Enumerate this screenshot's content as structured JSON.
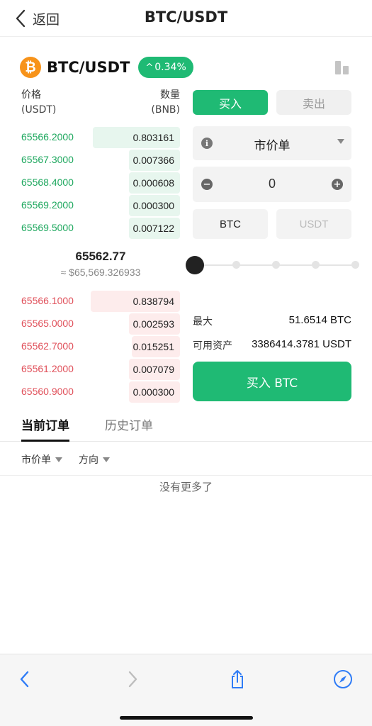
{
  "nav": {
    "back_label": "返回",
    "title": "BTC/USDT"
  },
  "pair": {
    "coin_symbol": "₿",
    "name": "BTC/USDT",
    "change": "0.34%",
    "change_color": "#1fba74"
  },
  "orderbook": {
    "price_header": "价格",
    "price_unit": "(USDT)",
    "qty_header": "数量",
    "qty_unit": "(BNB)",
    "bids": [
      {
        "price": "65566.2000",
        "qty": "0.803161",
        "depth": 0.55
      },
      {
        "price": "65567.3000",
        "qty": "0.007366",
        "depth": 0.32
      },
      {
        "price": "65568.4000",
        "qty": "0.000608",
        "depth": 0.32
      },
      {
        "price": "65569.2000",
        "qty": "0.000300",
        "depth": 0.32
      },
      {
        "price": "65569.5000",
        "qty": "0.007122",
        "depth": 0.32
      }
    ],
    "last_price": "65562.77",
    "last_price_usd": "≈ $65,569.326933",
    "asks": [
      {
        "price": "65566.1000",
        "qty": "0.838794",
        "depth": 0.56
      },
      {
        "price": "65565.0000",
        "qty": "0.002593",
        "depth": 0.32
      },
      {
        "price": "65562.7000",
        "qty": "0.015251",
        "depth": 0.3
      },
      {
        "price": "65561.2000",
        "qty": "0.007079",
        "depth": 0.32
      },
      {
        "price": "65560.9000",
        "qty": "0.000300",
        "depth": 0.32
      }
    ]
  },
  "trade": {
    "buy_tab": "买入",
    "sell_tab": "卖出",
    "order_type": "市价单",
    "amount": "0",
    "unit_btc": "BTC",
    "unit_usdt": "USDT",
    "slider_value": 0,
    "max_label": "最大",
    "max_value": "51.6514 BTC",
    "available_label": "可用资产",
    "available_value": "3386414.3781 USDT",
    "submit_label": "买入 BTC"
  },
  "orders": {
    "tab_current": "当前订单",
    "tab_history": "历史订单",
    "filter_type": "市价单",
    "filter_direction": "方向",
    "empty_text": "没有更多了"
  },
  "toolbar": {
    "icons": [
      "back-icon",
      "forward-icon",
      "share-icon",
      "compass-icon"
    ],
    "accent": "#2f7cf6"
  }
}
